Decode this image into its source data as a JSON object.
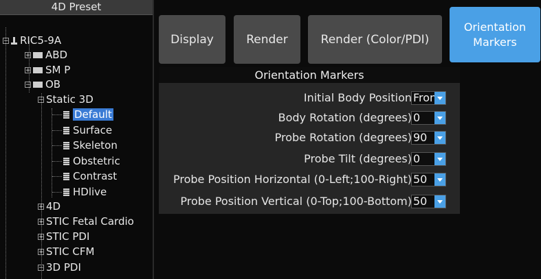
{
  "preset_panel": {
    "title": "4D Preset",
    "tree": {
      "probe": "RIC5-9A",
      "folders": {
        "abd": "ABD",
        "smp": "SM P",
        "ob": "OB"
      },
      "static3d": "Static 3D",
      "static3d_items": [
        "Default",
        "Surface",
        "Skeleton",
        "Obstetric",
        "Contrast",
        "HDlive"
      ],
      "other_items": [
        "4D",
        "STIC Fetal Cardio",
        "STIC PDI",
        "STIC CFM",
        "3D PDI"
      ]
    }
  },
  "tabs": {
    "display": "Display",
    "render": "Render",
    "render_color": "Render (Color/PDI)",
    "orientation_line1": "Orientation",
    "orientation_line2": "Markers"
  },
  "orientation_markers": {
    "title": "Orientation Markers",
    "rows": [
      {
        "label": "Initial Body Position",
        "value": "Front"
      },
      {
        "label": "Body Rotation (degrees)",
        "value": "0"
      },
      {
        "label": "Probe Rotation (degrees)",
        "value": "90"
      },
      {
        "label": "Probe Tilt (degrees)",
        "value": "0"
      },
      {
        "label": "Probe Position Horizontal (0-Left;100-Right)",
        "value": "50"
      },
      {
        "label": "Probe Position Vertical (0-Top;100-Bottom)",
        "value": "50"
      }
    ]
  },
  "colors": {
    "accent": "#4aa0e6",
    "tab_bg": "#4a4a4a",
    "selection": "#3a7bd5"
  }
}
